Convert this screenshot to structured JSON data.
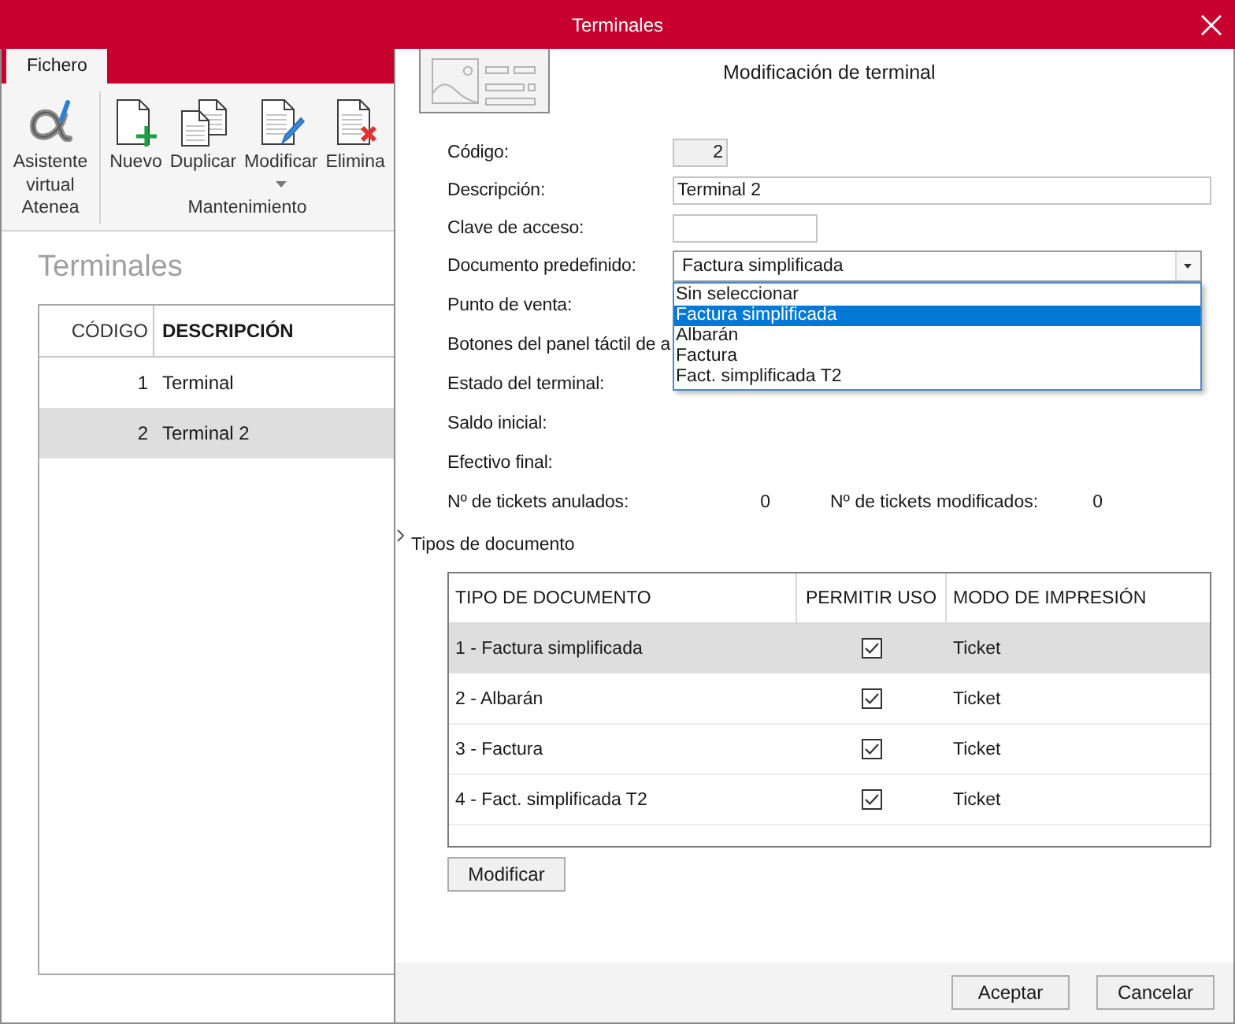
{
  "window": {
    "title": "Terminales"
  },
  "ribbon": {
    "tabs": [
      {
        "label": "Fichero",
        "selected": true
      }
    ],
    "groups": [
      {
        "label": "Atenea",
        "buttons": [
          {
            "kind": "assistant",
            "label": "Asistente virtual",
            "menu": false
          }
        ]
      },
      {
        "label": "Mantenimiento",
        "buttons": [
          {
            "kind": "new",
            "label": "Nuevo",
            "menu": false
          },
          {
            "kind": "duplicate",
            "label": "Duplicar",
            "menu": false
          },
          {
            "kind": "edit",
            "label": "Modificar",
            "menu": true
          },
          {
            "kind": "delete",
            "label": "Elimina",
            "menu": false
          }
        ]
      }
    ]
  },
  "list": {
    "title": "Terminales",
    "columns": [
      "CÓDIGO",
      "DESCRIPCIÓN"
    ],
    "rows": [
      {
        "code": "1",
        "description": "Terminal",
        "selected": false
      },
      {
        "code": "2",
        "description": "Terminal 2",
        "selected": true
      }
    ]
  },
  "dialog": {
    "title": "Modificación de terminal",
    "fields": [
      {
        "kind": "number",
        "label": "Código:",
        "value": "2",
        "disabled": true
      },
      {
        "kind": "text",
        "label": "Descripción:",
        "value": "Terminal 2",
        "disabled": false
      },
      {
        "kind": "key",
        "label": "Clave de acceso:",
        "disabled": false
      },
      {
        "kind": "select",
        "label": "Documento predefinido:",
        "value": "Factura simplificada",
        "disabled": false,
        "expanded": true,
        "options": [
          {
            "label": "Sin seleccionar",
            "selected": false
          },
          {
            "label": "Factura simplificada",
            "selected": true
          },
          {
            "label": "Albarán",
            "selected": false
          },
          {
            "label": "Factura",
            "selected": false
          },
          {
            "label": "Fact. simplificada T2",
            "selected": false
          }
        ]
      },
      {
        "kind": "label",
        "label": "Punto de venta:"
      },
      {
        "kind": "label",
        "label": "Botones del panel táctil de a"
      },
      {
        "kind": "label",
        "label": "Estado del terminal:"
      },
      {
        "kind": "label",
        "label": "Saldo inicial:"
      },
      {
        "kind": "label",
        "label": "Efectivo final:"
      },
      {
        "kind": "counts",
        "label": "Nº de tickets anulados:",
        "value": "0",
        "label_2": "Nº de tickets modificados:",
        "value_2": "0"
      }
    ],
    "documents": {
      "title": "Tipos de documento",
      "columns": [
        "TIPO DE DOCUMENTO",
        "PERMITIR USO",
        "MODO DE IMPRESIÓN"
      ],
      "rows": [
        {
          "type": "1 - Factura simplificada",
          "allowed": true,
          "print_mode": "Ticket",
          "selected": true
        },
        {
          "type": "2 - Albarán",
          "allowed": true,
          "print_mode": "Ticket",
          "selected": false
        },
        {
          "type": "3 - Factura",
          "allowed": true,
          "print_mode": "Ticket",
          "selected": false
        },
        {
          "type": "4 - Fact. simplificada T2",
          "allowed": true,
          "print_mode": "Ticket",
          "selected": false
        }
      ]
    },
    "edit_button": "Modificar"
  },
  "buttons": [
    "Aceptar",
    "Cancelar"
  ]
}
